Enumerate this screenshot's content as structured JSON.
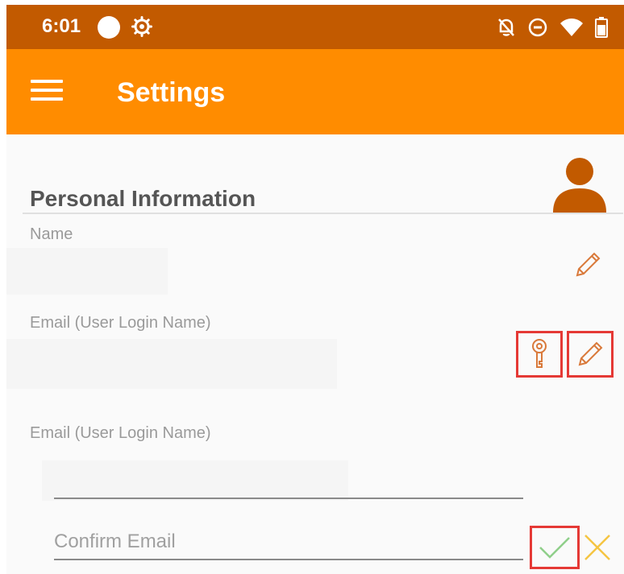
{
  "status_bar": {
    "time": "6:01",
    "icons": [
      "circle-icon",
      "gear-icon",
      "bell-off-icon",
      "do-not-disturb-icon",
      "wifi-icon",
      "battery-icon"
    ]
  },
  "app_bar": {
    "title": "Settings",
    "menu_icon": "hamburger-menu-icon",
    "background": "#ff8c00",
    "status_background": "#c25a00"
  },
  "personal_info": {
    "section_title": "Personal Information",
    "avatar_icon": "person-icon",
    "name": {
      "label": "Name",
      "value": "",
      "edit_icon": "pencil-icon"
    },
    "email": {
      "label": "Email (User Login Name)",
      "value": "",
      "key_icon": "key-icon",
      "edit_icon": "pencil-icon"
    },
    "email_edit": {
      "label": "Email (User Login Name)",
      "email_input_value": "",
      "email_input_placeholder": "",
      "confirm_input_value": "",
      "confirm_input_placeholder": "Confirm Email",
      "confirm_icon": "check-icon",
      "cancel_icon": "close-icon"
    }
  },
  "colors": {
    "accent": "#ff8c00",
    "icon": "#d9793a",
    "highlight_border": "#e53935",
    "avatar": "#c25a00",
    "cancel": "#f5c542",
    "check": "#8fcf8a"
  }
}
